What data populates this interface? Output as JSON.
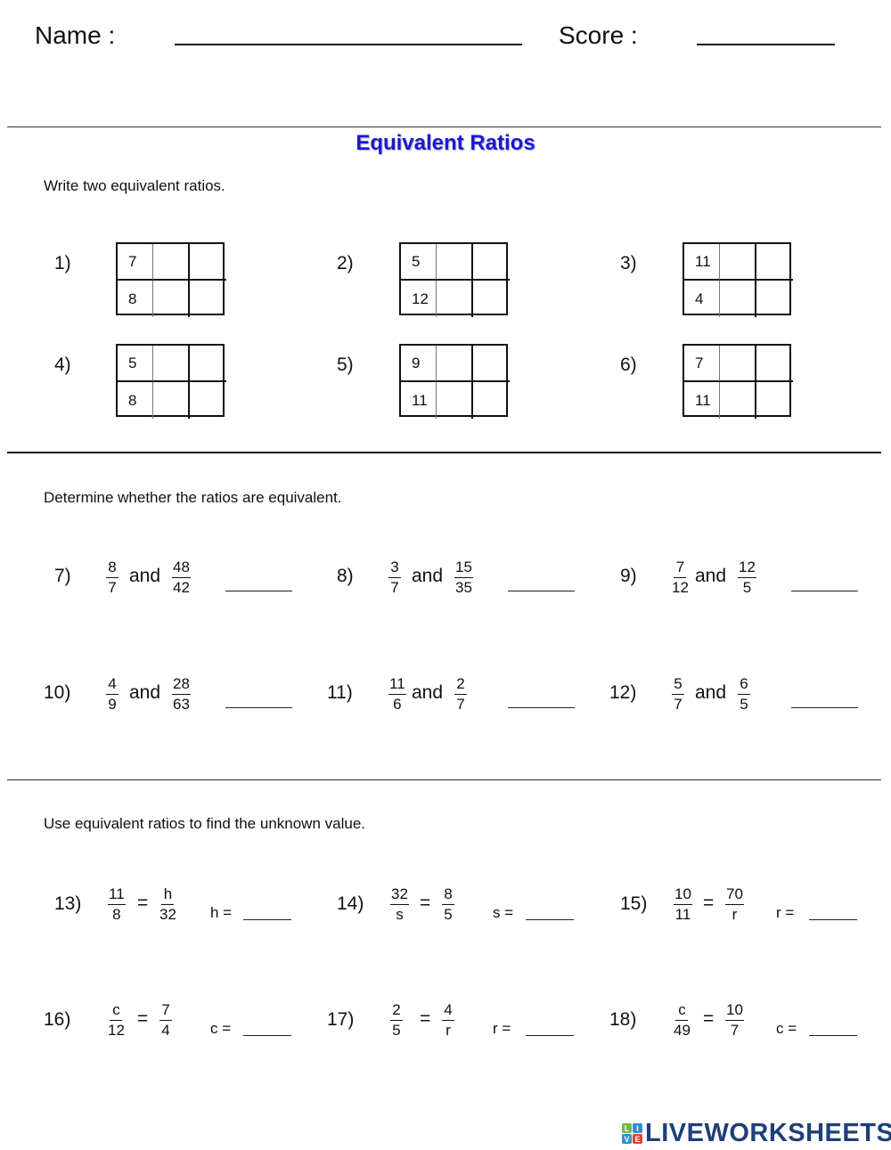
{
  "header": {
    "name_label": "Name :",
    "score_label": "Score :"
  },
  "title": "Equivalent Ratios",
  "title_color": "#1a1ad0",
  "sections": {
    "write": {
      "instruction": "Write two equivalent ratios.",
      "problems": [
        {
          "num": "1)",
          "top": "7",
          "bottom": "8"
        },
        {
          "num": "2)",
          "top": "5",
          "bottom": "12"
        },
        {
          "num": "3)",
          "top": "11",
          "bottom": "4"
        },
        {
          "num": "4)",
          "top": "5",
          "bottom": "8"
        },
        {
          "num": "5)",
          "top": "9",
          "bottom": "11"
        },
        {
          "num": "6)",
          "top": "7",
          "bottom": "11"
        }
      ]
    },
    "determine": {
      "instruction": "Determine whether the ratios are equivalent.",
      "connector": "and",
      "problems": [
        {
          "num": "7)",
          "a_num": "8",
          "a_den": "7",
          "b_num": "48",
          "b_den": "42"
        },
        {
          "num": "8)",
          "a_num": "3",
          "a_den": "7",
          "b_num": "15",
          "b_den": "35"
        },
        {
          "num": "9)",
          "a_num": "7",
          "a_den": "12",
          "b_num": "12",
          "b_den": "5"
        },
        {
          "num": "10)",
          "a_num": "4",
          "a_den": "9",
          "b_num": "28",
          "b_den": "63"
        },
        {
          "num": "11)",
          "a_num": "11",
          "a_den": "6",
          "b_num": "2",
          "b_den": "7"
        },
        {
          "num": "12)",
          "a_num": "5",
          "a_den": "7",
          "b_num": "6",
          "b_den": "5"
        }
      ]
    },
    "unknown": {
      "instruction": "Use equivalent ratios to find the unknown value.",
      "equals": "=",
      "problems": [
        {
          "num": "13)",
          "a_num": "11",
          "a_den": "8",
          "b_num": "h",
          "b_den": "32",
          "var": "h ="
        },
        {
          "num": "14)",
          "a_num": "32",
          "a_den": "s",
          "b_num": "8",
          "b_den": "5",
          "var": "s ="
        },
        {
          "num": "15)",
          "a_num": "10",
          "a_den": "11",
          "b_num": "70",
          "b_den": "r",
          "var": "r ="
        },
        {
          "num": "16)",
          "a_num": "c",
          "a_den": "12",
          "b_num": "7",
          "b_den": "4",
          "var": "c ="
        },
        {
          "num": "17)",
          "a_num": "2",
          "a_den": "5",
          "b_num": "4",
          "b_den": "r",
          "var": "r ="
        },
        {
          "num": "18)",
          "a_num": "c",
          "a_den": "49",
          "b_num": "10",
          "b_den": "7",
          "var": "c ="
        }
      ]
    }
  },
  "logo": {
    "tiles": [
      {
        "letter": "L",
        "color": "#6cbf3a"
      },
      {
        "letter": "I",
        "color": "#2f8fd8"
      },
      {
        "letter": "V",
        "color": "#2f8fd8"
      },
      {
        "letter": "E",
        "color": "#e0422f"
      }
    ],
    "text": "LIVEWORKSHEETS",
    "color": "#1f3f7a"
  }
}
